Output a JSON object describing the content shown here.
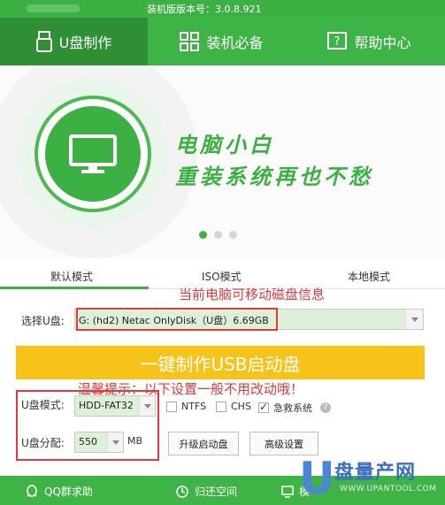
{
  "title_bar": {
    "version_text": "装机版版本号：3.0.8.921"
  },
  "nav": {
    "tabs": [
      {
        "label": "U盘制作",
        "icon": "usb-icon",
        "active": true
      },
      {
        "label": "装机必备",
        "icon": "grid-icon",
        "active": false
      },
      {
        "label": "帮助中心",
        "icon": "help-icon",
        "active": false
      }
    ]
  },
  "banner": {
    "slogan_line1": "电脑小白",
    "slogan_line2": "重装系统再也不愁",
    "active_dot": 0
  },
  "modes": {
    "tabs": [
      "默认模式",
      "ISO模式",
      "本地模式"
    ],
    "active": 0
  },
  "annotations": {
    "disk_info": "当前电脑可移动磁盘信息",
    "tip": "温馨提示：以下设置一般不用改动哦！"
  },
  "disk": {
    "label": "选择U盘:",
    "value": "G: (hd2) Netac OnlyDisk（U盘）6.69GB"
  },
  "make_button": "一键制作USB启动盘",
  "settings": {
    "mode_label": "U盘模式:",
    "mode_value": "HDD-FAT32",
    "ntfs": "NTFS",
    "chs": "CHS",
    "rescue": "急救系统",
    "rescue_checked": true,
    "alloc_label": "U盘分配:",
    "alloc_value": "550",
    "alloc_unit": "MB",
    "upgrade_button": "升级启动盘",
    "advanced_button": "高级设置"
  },
  "footer": {
    "qq": "QQ群求助",
    "restore": "归还空间",
    "mock": "模"
  },
  "watermark": {
    "letter": "U",
    "text": "盘量产网",
    "sub": "WWW.UPANTOOL.COM"
  },
  "colors": {
    "brand_green": "#3fb446",
    "yellow": "#f7c21a",
    "annotation_red": "#e23a3a"
  }
}
